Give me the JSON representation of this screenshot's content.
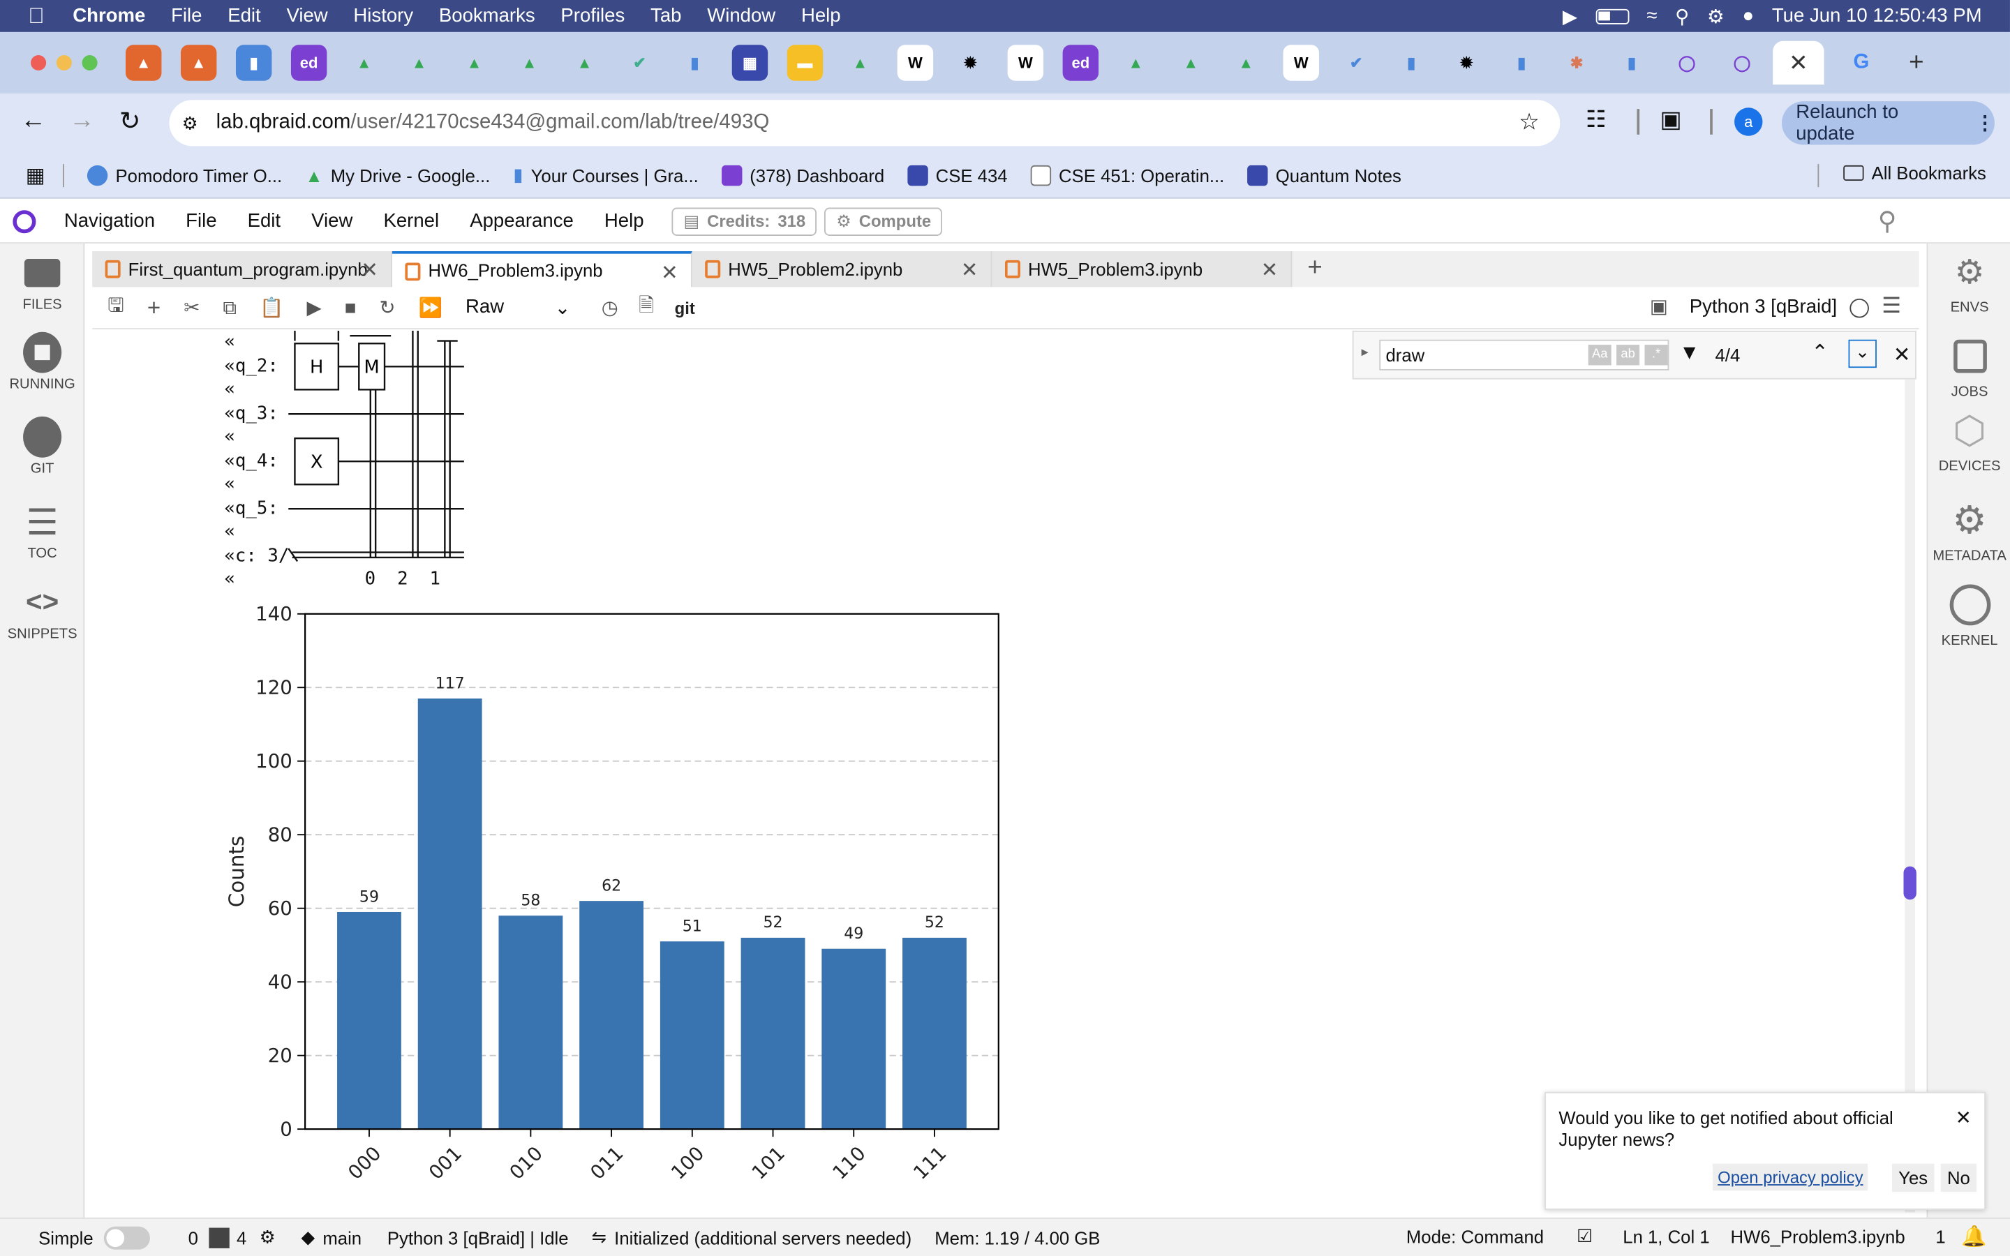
{
  "menubar": {
    "app": "Chrome",
    "items": [
      "File",
      "Edit",
      "View",
      "History",
      "Bookmarks",
      "Profiles",
      "Tab",
      "Window",
      "Help"
    ],
    "datetime": "Tue Jun 10  12:50:43 PM"
  },
  "browser": {
    "url_domain": "lab.qbraid.com",
    "url_path": "/user/42170cse434@gmail.com/lab/tree/493Q",
    "relaunch": "Relaunch to update",
    "profile_initial": "a",
    "bookmarks": [
      "Pomodoro Timer O...",
      "My Drive - Google...",
      "Your Courses | Gra...",
      "(378) Dashboard",
      "CSE 434",
      "CSE 451: Operatin...",
      "Quantum Notes"
    ],
    "all_bookmarks": "All Bookmarks"
  },
  "jupyter": {
    "menu": [
      "Navigation",
      "File",
      "Edit",
      "View",
      "Kernel",
      "Appearance",
      "Help"
    ],
    "credits_label": "Credits:",
    "credits_value": "318",
    "compute": "Compute",
    "left_sidebar": [
      "FILES",
      "RUNNING",
      "GIT",
      "TOC",
      "SNIPPETS"
    ],
    "right_sidebar": [
      "ENVS",
      "JOBS",
      "DEVICES",
      "METADATA",
      "KERNEL"
    ],
    "tabs": [
      "First_quantum_program.ipynb",
      "HW6_Problem3.ipynb",
      "HW5_Problem2.ipynb",
      "HW5_Problem3.ipynb"
    ],
    "cell_type": "Raw",
    "git": "git",
    "kernel": "Python 3 [qBraid]"
  },
  "find": {
    "query": "draw",
    "count": "4/4"
  },
  "circuit_text": "«\n«q_2: \n«\n«q_3: \n«\n«q_4: \n«\n«q_5: \n«\n«c: 3/\n«            0  2  1",
  "chart_data": {
    "type": "bar",
    "categories": [
      "000",
      "001",
      "010",
      "011",
      "100",
      "101",
      "110",
      "111"
    ],
    "values": [
      59,
      117,
      58,
      62,
      51,
      52,
      49,
      52
    ],
    "ylabel": "Counts",
    "xlabel": "",
    "title": "",
    "ylim": [
      0,
      140
    ],
    "yticks": [
      0,
      20,
      40,
      60,
      80,
      100,
      120,
      140
    ],
    "color": "#3a74b0",
    "grid": "horizontal dashed"
  },
  "notification": {
    "text": "Would you like to get notified about official Jupyter news?",
    "link": "Open privacy policy",
    "yes": "Yes",
    "no": "No"
  },
  "status": {
    "mode_simple": "Simple",
    "count1": "0",
    "count2": "4",
    "branch": "main",
    "kernel_status": "Python 3 [qBraid] | Idle",
    "init": "Initialized (additional servers needed)",
    "mem": "Mem: 1.19 / 4.00 GB",
    "mode": "Mode: Command",
    "pos": "Ln 1, Col 1",
    "file": "HW6_Problem3.ipynb",
    "notif_count": "1"
  }
}
